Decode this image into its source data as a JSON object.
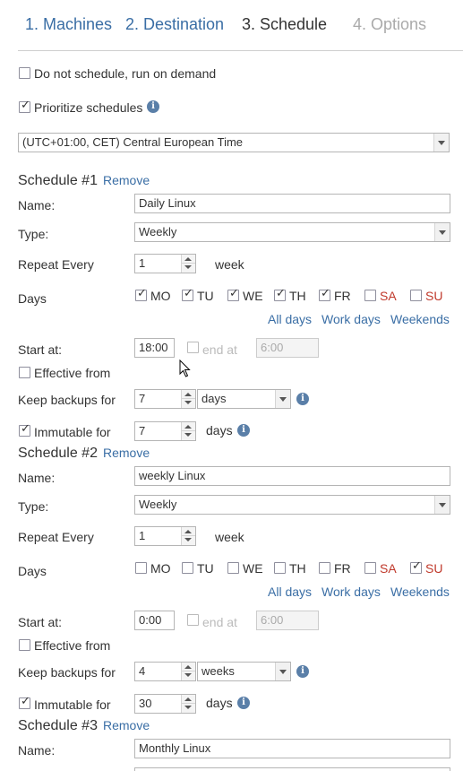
{
  "steps": [
    {
      "label": "1. Machines",
      "state": "done"
    },
    {
      "label": "2. Destination",
      "state": "done"
    },
    {
      "label": "3. Schedule",
      "state": "current"
    },
    {
      "label": "4. Options",
      "state": "future"
    }
  ],
  "options": {
    "do_not_schedule": {
      "label": "Do not schedule, run on demand",
      "checked": false
    },
    "prioritize": {
      "label": "Prioritize schedules",
      "checked": true
    },
    "timezone": "(UTC+01:00, CET) Central European Time"
  },
  "labels": {
    "remove": "Remove",
    "name": "Name:",
    "type": "Type:",
    "repeat_every": "Repeat Every",
    "days": "Days",
    "all_days": "All days",
    "work_days": "Work days",
    "weekends": "Weekends",
    "start_at": "Start at:",
    "end_at": "end at",
    "effective_from": "Effective from",
    "keep_backups_for": "Keep backups for",
    "immutable_for": "Immutable for",
    "days_unit": "days"
  },
  "day_names": [
    "MO",
    "TU",
    "WE",
    "TH",
    "FR",
    "SA",
    "SU"
  ],
  "schedules": [
    {
      "title": "Schedule #1",
      "name": "Daily Linux",
      "type": "Weekly",
      "repeat_value": "1",
      "repeat_unit": "week",
      "days_checked": [
        true,
        true,
        true,
        true,
        true,
        false,
        false
      ],
      "start_at": "18:00",
      "end_at_checked": false,
      "end_at": "6:00",
      "effective_from_checked": false,
      "keep_value": "7",
      "keep_unit": "days",
      "immutable_checked": true,
      "immutable_value": "7"
    },
    {
      "title": "Schedule #2",
      "name": "weekly Linux",
      "type": "Weekly",
      "repeat_value": "1",
      "repeat_unit": "week",
      "days_checked": [
        false,
        false,
        false,
        false,
        false,
        false,
        true
      ],
      "start_at": "0:00",
      "end_at_checked": false,
      "end_at": "6:00",
      "effective_from_checked": false,
      "keep_value": "4",
      "keep_unit": "weeks",
      "immutable_checked": true,
      "immutable_value": "30"
    },
    {
      "title": "Schedule #3",
      "name": "Monthly Linux"
    }
  ],
  "colors": {
    "link": "#3a6ea5",
    "weekend": "#c0392b",
    "current_step": "#333333",
    "future_step": "#aaaaaa"
  }
}
